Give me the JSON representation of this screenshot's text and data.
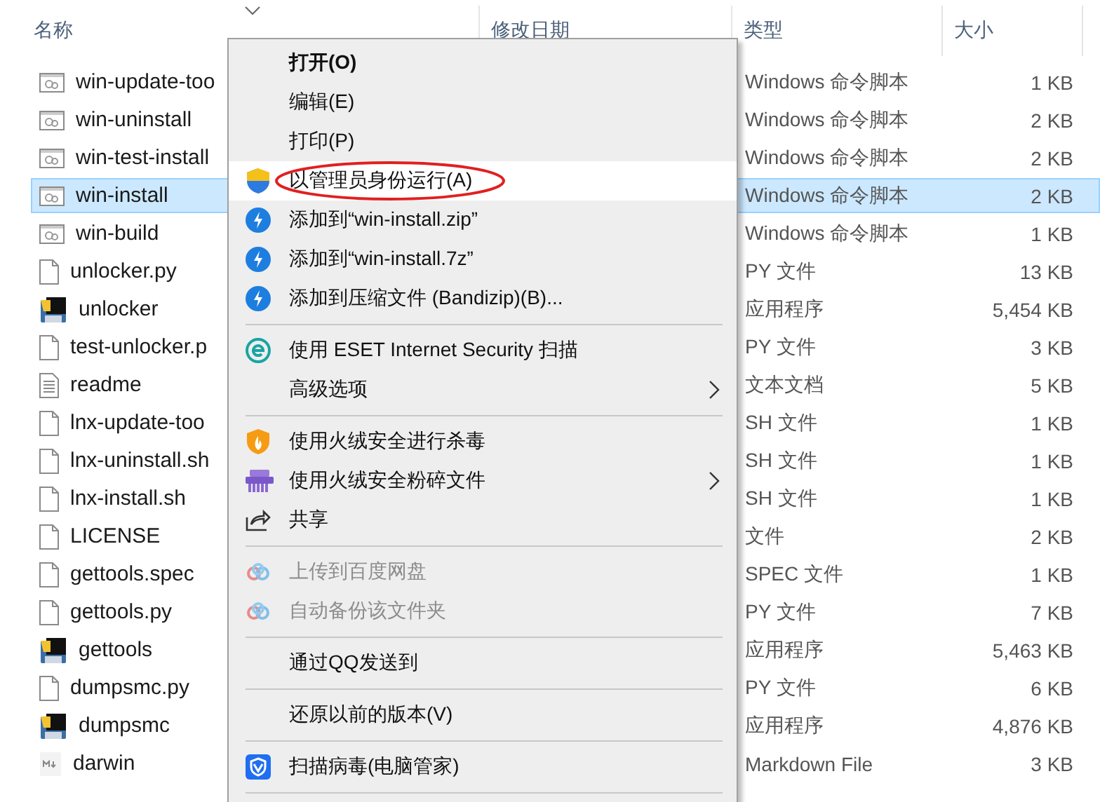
{
  "columns": [
    {
      "label": "名称",
      "sorted": true
    },
    {
      "label": "修改日期",
      "sorted": false
    },
    {
      "label": "类型",
      "sorted": false
    },
    {
      "label": "大小",
      "sorted": false
    }
  ],
  "files": [
    {
      "name": "win-update-too",
      "kind": "script",
      "type": "Windows 命令脚本",
      "size": "1 KB",
      "selected": false
    },
    {
      "name": "win-uninstall",
      "kind": "script",
      "type": "Windows 命令脚本",
      "size": "2 KB",
      "selected": false
    },
    {
      "name": "win-test-install",
      "kind": "script",
      "type": "Windows 命令脚本",
      "size": "2 KB",
      "selected": false
    },
    {
      "name": "win-install",
      "kind": "script",
      "type": "Windows 命令脚本",
      "size": "2 KB",
      "selected": true
    },
    {
      "name": "win-build",
      "kind": "script",
      "type": "Windows 命令脚本",
      "size": "1 KB",
      "selected": false
    },
    {
      "name": "unlocker.py",
      "kind": "blank",
      "type": "PY 文件",
      "size": "13 KB",
      "selected": false
    },
    {
      "name": "unlocker",
      "kind": "app",
      "type": "应用程序",
      "size": "5,454 KB",
      "selected": false
    },
    {
      "name": "test-unlocker.p",
      "kind": "blank",
      "type": "PY 文件",
      "size": "3 KB",
      "selected": false
    },
    {
      "name": "readme",
      "kind": "text",
      "type": "文本文档",
      "size": "5 KB",
      "selected": false
    },
    {
      "name": "lnx-update-too",
      "kind": "blank",
      "type": "SH 文件",
      "size": "1 KB",
      "selected": false
    },
    {
      "name": "lnx-uninstall.sh",
      "kind": "blank",
      "type": "SH 文件",
      "size": "1 KB",
      "selected": false
    },
    {
      "name": "lnx-install.sh",
      "kind": "blank",
      "type": "SH 文件",
      "size": "1 KB",
      "selected": false
    },
    {
      "name": "LICENSE",
      "kind": "blank",
      "type": "文件",
      "size": "2 KB",
      "selected": false
    },
    {
      "name": "gettools.spec",
      "kind": "blank",
      "type": "SPEC 文件",
      "size": "1 KB",
      "selected": false
    },
    {
      "name": "gettools.py",
      "kind": "blank",
      "type": "PY 文件",
      "size": "7 KB",
      "selected": false
    },
    {
      "name": "gettools",
      "kind": "app",
      "type": "应用程序",
      "size": "5,463 KB",
      "selected": false
    },
    {
      "name": "dumpsmc.py",
      "kind": "blank",
      "type": "PY 文件",
      "size": "6 KB",
      "selected": false
    },
    {
      "name": "dumpsmc",
      "kind": "app",
      "type": "应用程序",
      "size": "4,876 KB",
      "selected": false
    },
    {
      "name": "darwin",
      "kind": "markdown",
      "type": "Markdown File",
      "size": "3 KB",
      "selected": false
    }
  ],
  "context_menu": {
    "groups": [
      [
        {
          "label": "打开(O)",
          "bold": true
        },
        {
          "label": "编辑(E)"
        },
        {
          "label": "打印(P)"
        },
        {
          "label": "以管理员身份运行(A)",
          "kind": "shield",
          "highlighted": true,
          "circled": true
        },
        {
          "label": "添加到“win-install.zip”",
          "kind": "bandizip"
        },
        {
          "label": "添加到“win-install.7z”",
          "kind": "bandizip"
        },
        {
          "label": "添加到压缩文件 (Bandizip)(B)...",
          "kind": "bandizip"
        }
      ],
      [
        {
          "label": "使用 ESET Internet Security 扫描",
          "kind": "eset"
        },
        {
          "label": "高级选项",
          "submenu": true
        }
      ],
      [
        {
          "label": "使用火绒安全进行杀毒",
          "kind": "flame"
        },
        {
          "label": "使用火绒安全粉碎文件",
          "kind": "shredder",
          "submenu": true
        },
        {
          "label": "共享",
          "kind": "share"
        }
      ],
      [
        {
          "label": "上传到百度网盘",
          "kind": "cloud",
          "disabled": true
        },
        {
          "label": "自动备份该文件夹",
          "kind": "cloud",
          "disabled": true
        }
      ],
      [
        {
          "label": "通过QQ发送到"
        }
      ],
      [
        {
          "label": "还原以前的版本(V)"
        }
      ],
      [
        {
          "label": "扫描病毒(电脑管家)",
          "kind": "tencent"
        }
      ]
    ]
  }
}
